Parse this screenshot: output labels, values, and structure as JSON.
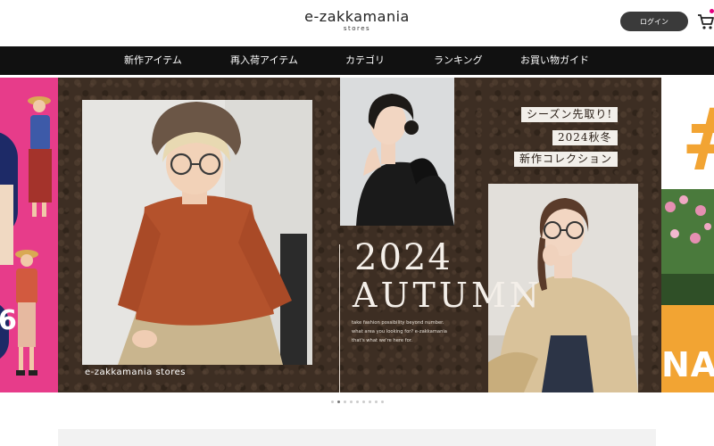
{
  "header": {
    "logo_main": "e-zakkamania",
    "logo_sub": "stores",
    "login_label": "ログイン"
  },
  "nav": {
    "items": [
      {
        "label": "新作アイテム"
      },
      {
        "label": "再入荷アイテム"
      },
      {
        "label": "カテゴリ"
      },
      {
        "label": "ランキング"
      },
      {
        "label": "お買い物ガイド"
      }
    ]
  },
  "hero": {
    "season_lines": [
      "シーズン先取り!",
      "2024秋冬",
      "新作コレクション"
    ],
    "year": "2024",
    "season": "AUTUMN",
    "tagline": [
      "take fashion possibility beyond number.",
      "what area you looking for? e-zakkamania",
      "that's what we're here for."
    ],
    "photo_caption": "e-zakkamania stores",
    "right_slide_text": "NA",
    "left_slide_text": "6"
  },
  "carousel": {
    "slide_count": 9,
    "active_index": 1
  },
  "colors": {
    "nav_bg": "#111111",
    "brand_brown": "#3d2e23",
    "left_slide_pink": "#e73c8a",
    "right_slide_orange": "#f2a433",
    "login_bg": "#3a3a3a"
  }
}
